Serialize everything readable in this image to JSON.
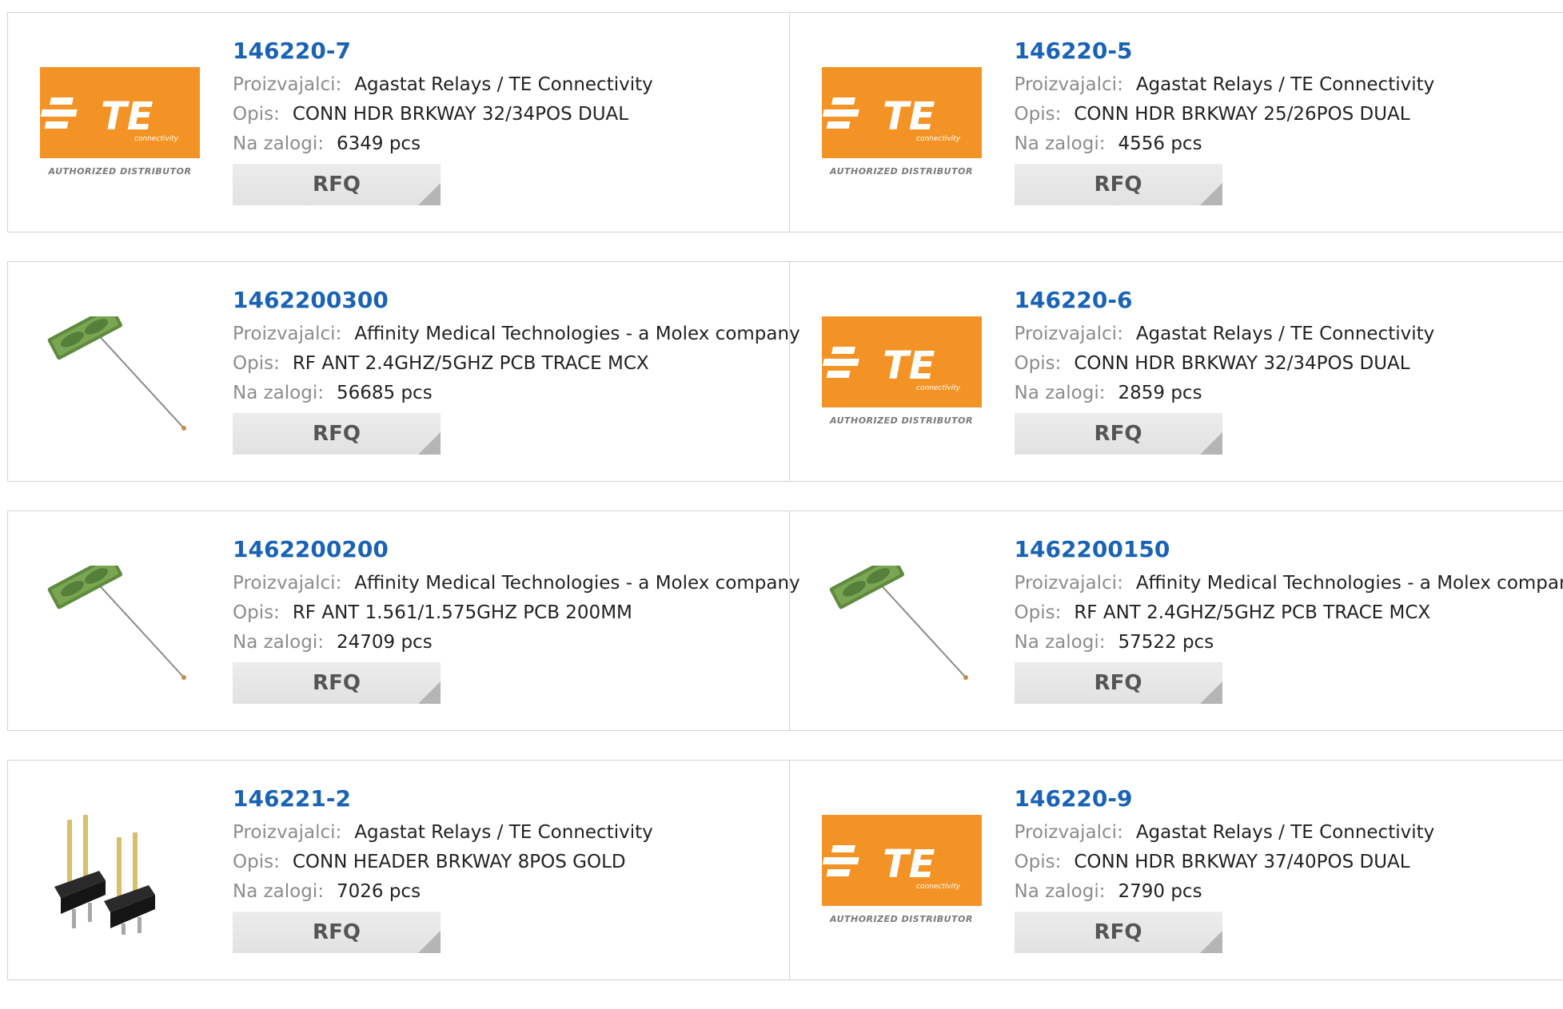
{
  "labels": {
    "manufacturer": "Proizvajalci:",
    "description": "Opis:",
    "stock": "Na zalogi:",
    "rfq": "RFQ"
  },
  "logo": {
    "te_text": "TE",
    "te_sub": "connectivity",
    "te_auth": "AUTHORIZED DISTRIBUTOR"
  },
  "colors": {
    "link": "#1a63b4",
    "te_orange": "#f39325"
  },
  "products": [
    {
      "part": "146220-7",
      "manufacturer": "Agastat Relays / TE Connectivity",
      "description": "CONN HDR BRKWAY 32/34POS DUAL",
      "stock": "6349 pcs",
      "image": "te-logo"
    },
    {
      "part": "146220-5",
      "manufacturer": "Agastat Relays / TE Connectivity",
      "description": "CONN HDR BRKWAY 25/26POS DUAL",
      "stock": "4556 pcs",
      "image": "te-logo"
    },
    {
      "part": "1462200300",
      "manufacturer": "Affinity Medical Technologies - a Molex company",
      "description": "RF ANT 2.4GHZ/5GHZ PCB TRACE MCX",
      "stock": "56685 pcs",
      "image": "antenna"
    },
    {
      "part": "146220-6",
      "manufacturer": "Agastat Relays / TE Connectivity",
      "description": "CONN HDR BRKWAY 32/34POS DUAL",
      "stock": "2859 pcs",
      "image": "te-logo"
    },
    {
      "part": "1462200200",
      "manufacturer": "Affinity Medical Technologies - a Molex company",
      "description": "RF ANT 1.561/1.575GHZ PCB 200MM",
      "stock": "24709 pcs",
      "image": "antenna"
    },
    {
      "part": "1462200150",
      "manufacturer": "Affinity Medical Technologies - a Molex company",
      "description": "RF ANT 2.4GHZ/5GHZ PCB TRACE MCX",
      "stock": "57522 pcs",
      "image": "antenna"
    },
    {
      "part": "146221-2",
      "manufacturer": "Agastat Relays / TE Connectivity",
      "description": "CONN HEADER BRKWAY 8POS GOLD",
      "stock": "7026 pcs",
      "image": "pin-header"
    },
    {
      "part": "146220-9",
      "manufacturer": "Agastat Relays / TE Connectivity",
      "description": "CONN HDR BRKWAY 37/40POS DUAL",
      "stock": "2790 pcs",
      "image": "te-logo"
    }
  ]
}
